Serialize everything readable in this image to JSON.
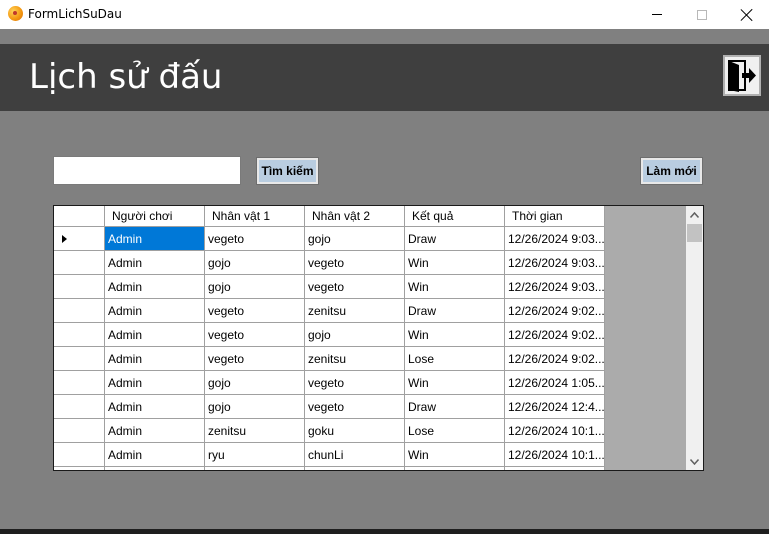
{
  "window": {
    "title": "FormLichSuDau"
  },
  "header": {
    "title": "Lịch sử đấu"
  },
  "toolbar": {
    "search_value": "",
    "search_label": "Tìm kiếm",
    "refresh_label": "Làm mới"
  },
  "grid": {
    "columns": [
      "Người chơi",
      "Nhân vật 1",
      "Nhân vật 2",
      "Kết quả",
      "Thời gian"
    ],
    "selected_row": 0,
    "rows": [
      [
        "Admin",
        "vegeto",
        "gojo",
        "Draw",
        "12/26/2024 9:03..."
      ],
      [
        "Admin",
        "gojo",
        "vegeto",
        "Win",
        "12/26/2024 9:03..."
      ],
      [
        "Admin",
        "gojo",
        "vegeto",
        "Win",
        "12/26/2024 9:03..."
      ],
      [
        "Admin",
        "vegeto",
        "zenitsu",
        "Draw",
        "12/26/2024 9:02..."
      ],
      [
        "Admin",
        "vegeto",
        "gojo",
        "Win",
        "12/26/2024 9:02..."
      ],
      [
        "Admin",
        "vegeto",
        "zenitsu",
        "Lose",
        "12/26/2024 9:02..."
      ],
      [
        "Admin",
        "gojo",
        "vegeto",
        "Win",
        "12/26/2024 1:05..."
      ],
      [
        "Admin",
        "gojo",
        "vegeto",
        "Draw",
        "12/26/2024 12:4..."
      ],
      [
        "Admin",
        "zenitsu",
        "goku",
        "Lose",
        "12/26/2024 10:1..."
      ],
      [
        "Admin",
        "ryu",
        "chunLi",
        "Win",
        "12/26/2024 10:1..."
      ],
      [
        "",
        "",
        "",
        "",
        ""
      ]
    ]
  },
  "colors": {
    "header_bg": "#3f3f3f",
    "body_bg": "#808080",
    "button_bg": "#b9cde0",
    "selection": "#0078d7"
  }
}
